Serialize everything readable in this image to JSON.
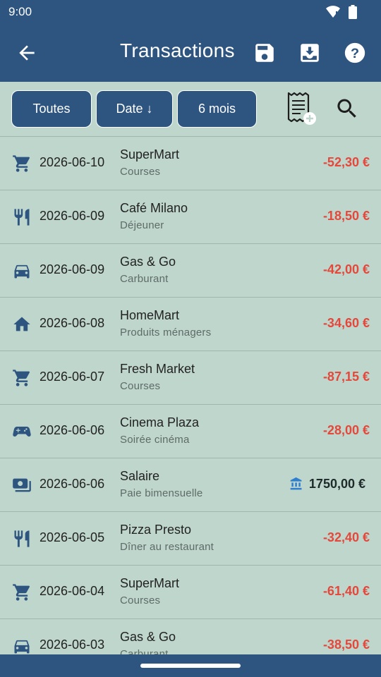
{
  "status": {
    "time": "9:00"
  },
  "header": {
    "title": "Transactions"
  },
  "filters": {
    "type": "Toutes",
    "sort": "Date ↓",
    "period": "6 mois"
  },
  "colors": {
    "primary": "#2e5580",
    "background": "#bfd6cc",
    "expense": "#e5473b",
    "income": "#1f2a2a",
    "bank_icon": "#2f7fd0"
  },
  "transactions": [
    {
      "icon": "cart-icon",
      "date": "2026-06-10",
      "name": "SuperMart",
      "category": "Courses",
      "amount": "-52,30 €"
    },
    {
      "icon": "fork-knife-icon",
      "date": "2026-06-09",
      "name": "Café Milano",
      "category": "Déjeuner",
      "amount": "-18,50 €"
    },
    {
      "icon": "car-icon",
      "date": "2026-06-09",
      "name": "Gas & Go",
      "category": "Carburant",
      "amount": "-42,00 €"
    },
    {
      "icon": "home-icon",
      "date": "2026-06-08",
      "name": "HomeMart",
      "category": "Produits ménagers",
      "amount": "-34,60 €"
    },
    {
      "icon": "cart-icon",
      "date": "2026-06-07",
      "name": "Fresh Market",
      "category": "Courses",
      "amount": "-87,15 €"
    },
    {
      "icon": "gamepad-icon",
      "date": "2026-06-06",
      "name": "Cinema Plaza",
      "category": "Soirée cinéma",
      "amount": "-28,00 €"
    },
    {
      "icon": "cash-icon",
      "date": "2026-06-06",
      "name": "Salaire",
      "category": "Paie bimensuelle",
      "amount": "1750,00 €"
    },
    {
      "icon": "fork-knife-icon",
      "date": "2026-06-05",
      "name": "Pizza Presto",
      "category": "Dîner au restaurant",
      "amount": "-32,40 €"
    },
    {
      "icon": "cart-icon",
      "date": "2026-06-04",
      "name": "SuperMart",
      "category": "Courses",
      "amount": "-61,40 €"
    },
    {
      "icon": "car-icon",
      "date": "2026-06-03",
      "name": "Gas & Go",
      "category": "Carburant",
      "amount": "-38,50 €"
    }
  ]
}
